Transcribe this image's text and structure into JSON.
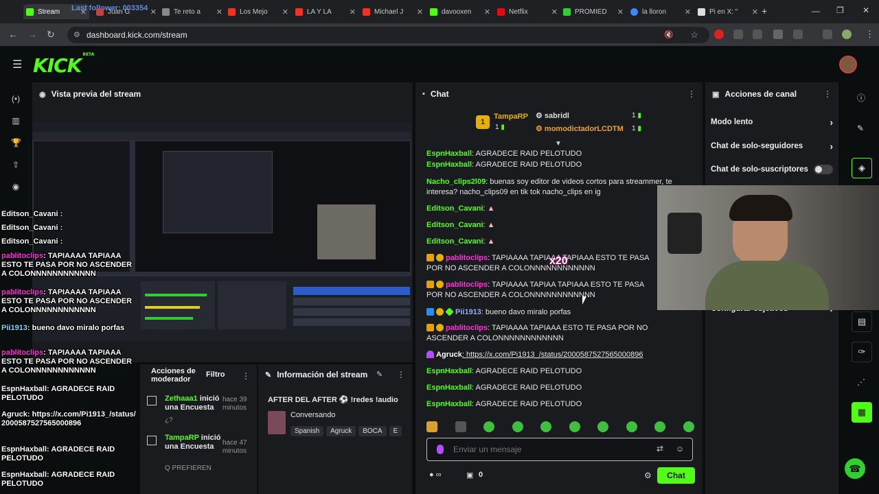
{
  "browser": {
    "tabs": [
      {
        "label": "Stream",
        "favicon_color": "#53fc18",
        "active": true
      },
      {
        "label": "Juan G",
        "favicon_color": "#b44",
        "active": false
      },
      {
        "label": "Te reto a",
        "favicon_color": "#888",
        "active": false
      },
      {
        "label": "Los Mejo",
        "favicon_color": "#e32",
        "active": false
      },
      {
        "label": "LA Y LA",
        "favicon_color": "#e32",
        "active": false
      },
      {
        "label": "Michael J",
        "favicon_color": "#e32",
        "active": false
      },
      {
        "label": "davooxen",
        "favicon_color": "#53fc18",
        "active": false
      },
      {
        "label": "Netflix",
        "favicon_color": "#e50914",
        "active": false
      },
      {
        "label": "PROMIED",
        "favicon_color": "#3c3",
        "active": false
      },
      {
        "label": "la lloron",
        "favicon_color": "#4285f4",
        "active": false
      },
      {
        "label": "Pi en X: \"",
        "favicon_color": "#ddd",
        "active": false
      }
    ],
    "overlay_text": "Last follower: 003354",
    "url": "dashboard.kick.com/stream"
  },
  "kick": {
    "logo": "KICK",
    "logo_badge": "BETA"
  },
  "preview": {
    "title": "Vista previa del stream"
  },
  "overlay_chat": [
    {
      "user": "Editson_Cavani",
      "text": ":",
      "user_color": "#ffffff"
    },
    {
      "user": "Editson_Cavani",
      "text": ":",
      "user_color": "#ffffff"
    },
    {
      "user": "Editson_Cavani",
      "text": ":",
      "user_color": "#ffffff"
    },
    {
      "user": "pablitoclips",
      "text": ": TAPIAAAA TAPIAAA ESTO TE PASA POR NO ASCENDER A COLONNNNNNNNNNNN",
      "user_color": "#ff2fd8"
    },
    {
      "user": "pablitoclips",
      "text": ": TAPIAAAA TAPIAAA ESTO TE PASA POR NO ASCENDER A COLONNNNNNNNNNNN",
      "user_color": "#ff2fd8"
    },
    {
      "user": "Pii1913",
      "text": ": bueno davo miralo porfas",
      "user_color": "#7fd8ff"
    },
    {
      "user": "pablitoclips",
      "text": ": TAPIAAAA TAPIAAA ESTO TE PASA POR NO ASCENDER A COLONNNNNNNNNNNN",
      "user_color": "#ff2fd8"
    },
    {
      "user": "EspnHaxball",
      "text": ": AGRADECE RAID PELOTUDO",
      "user_color": "#ffffff"
    },
    {
      "user": "Agruck",
      "text": ": https://x.com/Pi1913_/status/2000587527565000896",
      "user_color": "#ffffff"
    },
    {
      "user": "EspnHaxball",
      "text": ": AGRADECE RAID PELOTUDO",
      "user_color": "#ffffff"
    },
    {
      "user": "EspnHaxball",
      "text": ": AGRADECE RAID PELOTUDO",
      "user_color": "#ffffff"
    }
  ],
  "chat": {
    "title": "Chat",
    "pinned": {
      "rank1": "1",
      "user1": "TampaRP",
      "count1": "1",
      "user2": "sabridl",
      "count2": "1",
      "user3": "momodictadorLCDTM",
      "count3": "1"
    },
    "messages": [
      {
        "user": "EspnHaxball",
        "text": ": AGRADECE RAID PELOTUDO",
        "color": "#53fc18"
      },
      {
        "user": "Nacho_clips2l09",
        "text": ": buenas soy editor de videos cortos para streammer, te interesa? nacho_clips09 en tik tok nacho_clips en ig",
        "color": "#53fc18"
      },
      {
        "user": "Editson_Cavani",
        "text": ":",
        "color": "#53fc18"
      },
      {
        "user": "Editson_Cavani",
        "text": ":",
        "color": "#53fc18"
      },
      {
        "user": "Editson_Cavani",
        "text": ":",
        "color": "#53fc18"
      },
      {
        "user": "pablitoclips",
        "text": ": TAPIAAAA TAPIAAA TAPIAAA ESTO TE PASA POR NO ASCENDER A COLONNNNNNNNNNNN",
        "color": "#ff2fd8"
      },
      {
        "user": "pablitoclips",
        "text": ": TAPIAAAA TAPIAA TAPIAAA ESTO TE PASA POR NO ASCENDER A COLONNNNNNNNNNNN",
        "color": "#ff2fd8"
      },
      {
        "user": "Pii1913",
        "text": ": bueno davo miralo porfas",
        "color": "#7fa8ff"
      },
      {
        "user": "pablitoclips",
        "text": ": TAPIAAAA TAPIAAA ESTO TE PASA POR NO ASCENDER A COLONNNNNNNNNNNN",
        "color": "#ff2fd8"
      },
      {
        "user": "Agruck",
        "text": ": https://x.com/Pi1913_/status/2000587527565000896",
        "color": "#ffffff"
      },
      {
        "user": "EspnHaxball",
        "text": ": AGRADECE RAID PELOTUDO",
        "color": "#53fc18"
      },
      {
        "user": "EspnHaxball",
        "text": ": AGRADECE RAID PELOTUDO",
        "color": "#53fc18"
      },
      {
        "user": "EspnHaxball",
        "text": ": AGRADECE RAID PELOTUDO",
        "color": "#53fc18"
      }
    ],
    "input_placeholder": "Enviar un mensaje",
    "viewer_count": "0",
    "send_label": "Chat",
    "emote_gift": "x20"
  },
  "actions": {
    "title": "Acciones de canal",
    "slow_mode": "Modo lento",
    "followers_only": "Chat de solo-seguidores",
    "subs_only": "Chat de solo-suscriptores",
    "goals": "Configurar objetivos"
  },
  "mod_actions": {
    "title": "Acciones de moderador",
    "filter": "Filtro",
    "items": [
      {
        "user": "Zethaaa1",
        "action": "inició una Encuesta",
        "time": "hace 39 minutos",
        "detail": "¿?"
      },
      {
        "user": "TampaRP",
        "action": "inició una Encuesta",
        "time": "hace 47 minutos",
        "detail": "Q PREFIEREN"
      }
    ]
  },
  "stream_info": {
    "title_header": "Información del stream",
    "stream_title": "AFTER DEL AFTER ⚽ !redes !audio",
    "category": "Conversando",
    "tags": [
      "Spanish",
      "Agruck",
      "BOCA",
      "E"
    ]
  },
  "colors": {
    "kick_green": "#53fc18",
    "panel": "#191b1f",
    "background": "#0b0e0f"
  }
}
